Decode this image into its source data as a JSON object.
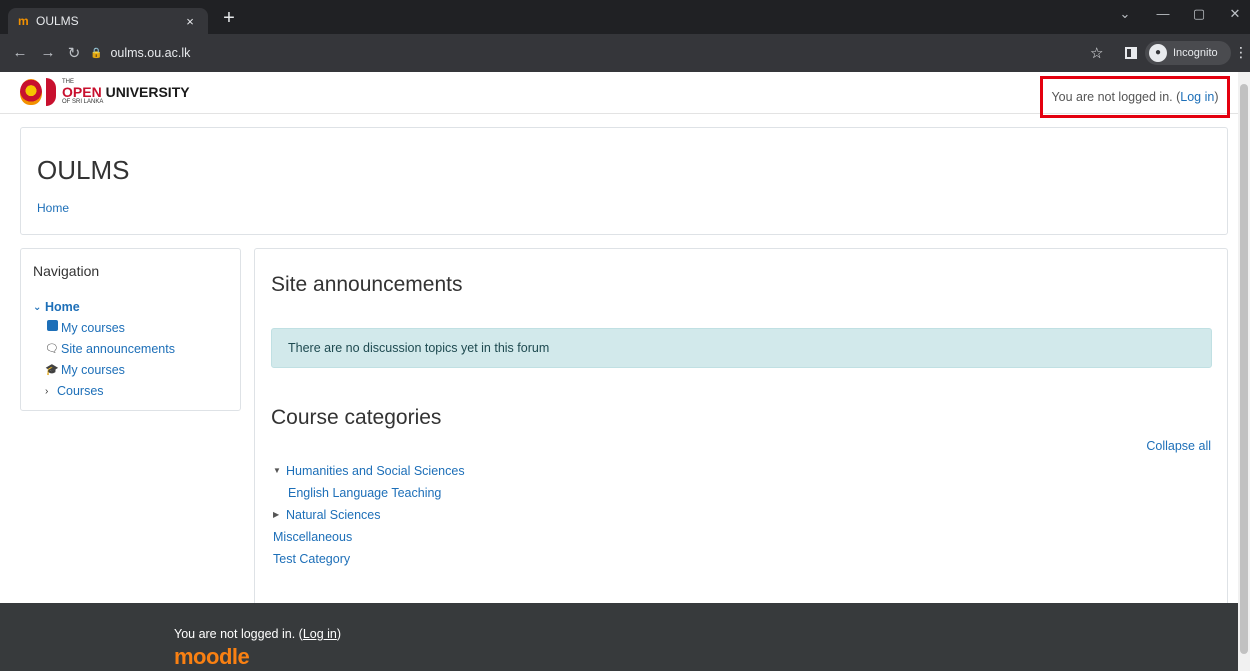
{
  "browser": {
    "tab_favicon": "m",
    "tab_title": "OULMS",
    "tab_close": "×",
    "new_tab": "+",
    "url": "oulms.ou.ac.lk",
    "incognito_label": "Incognito",
    "window_controls": [
      "⌄",
      "—",
      "▢",
      "✕"
    ]
  },
  "logo": {
    "the": "THE",
    "open": "OPEN",
    "university": " UNIVERSITY",
    "sub": "OF SRI LANKA"
  },
  "header": {
    "login_prefix": "You are not logged in. (",
    "login_link": "Log in",
    "login_suffix": ")"
  },
  "site": {
    "title": "OULMS",
    "breadcrumb": "Home"
  },
  "navigation": {
    "title": "Navigation",
    "home": "Home",
    "items": [
      "My courses",
      "Site announcements",
      "My courses",
      "Courses"
    ]
  },
  "main": {
    "announcements_heading": "Site announcements",
    "alert_text": "There are no discussion topics yet in this forum",
    "categories_heading": "Course categories",
    "collapse_all": "Collapse all",
    "categories": [
      "Humanities and Social Sciences",
      "English Language Teaching",
      "Natural Sciences",
      "Miscellaneous",
      "Test Category"
    ]
  },
  "footer": {
    "login_prefix": "You are not logged in. (",
    "login_link": "Log in",
    "login_suffix": ")",
    "brand": "moodle"
  },
  "colors": {
    "link": "#1d6fb8",
    "alert_bg": "#d2e9eb",
    "footer_bg": "#373a3c",
    "highlight_border": "#e4000f",
    "moodle_orange": "#f98012"
  }
}
